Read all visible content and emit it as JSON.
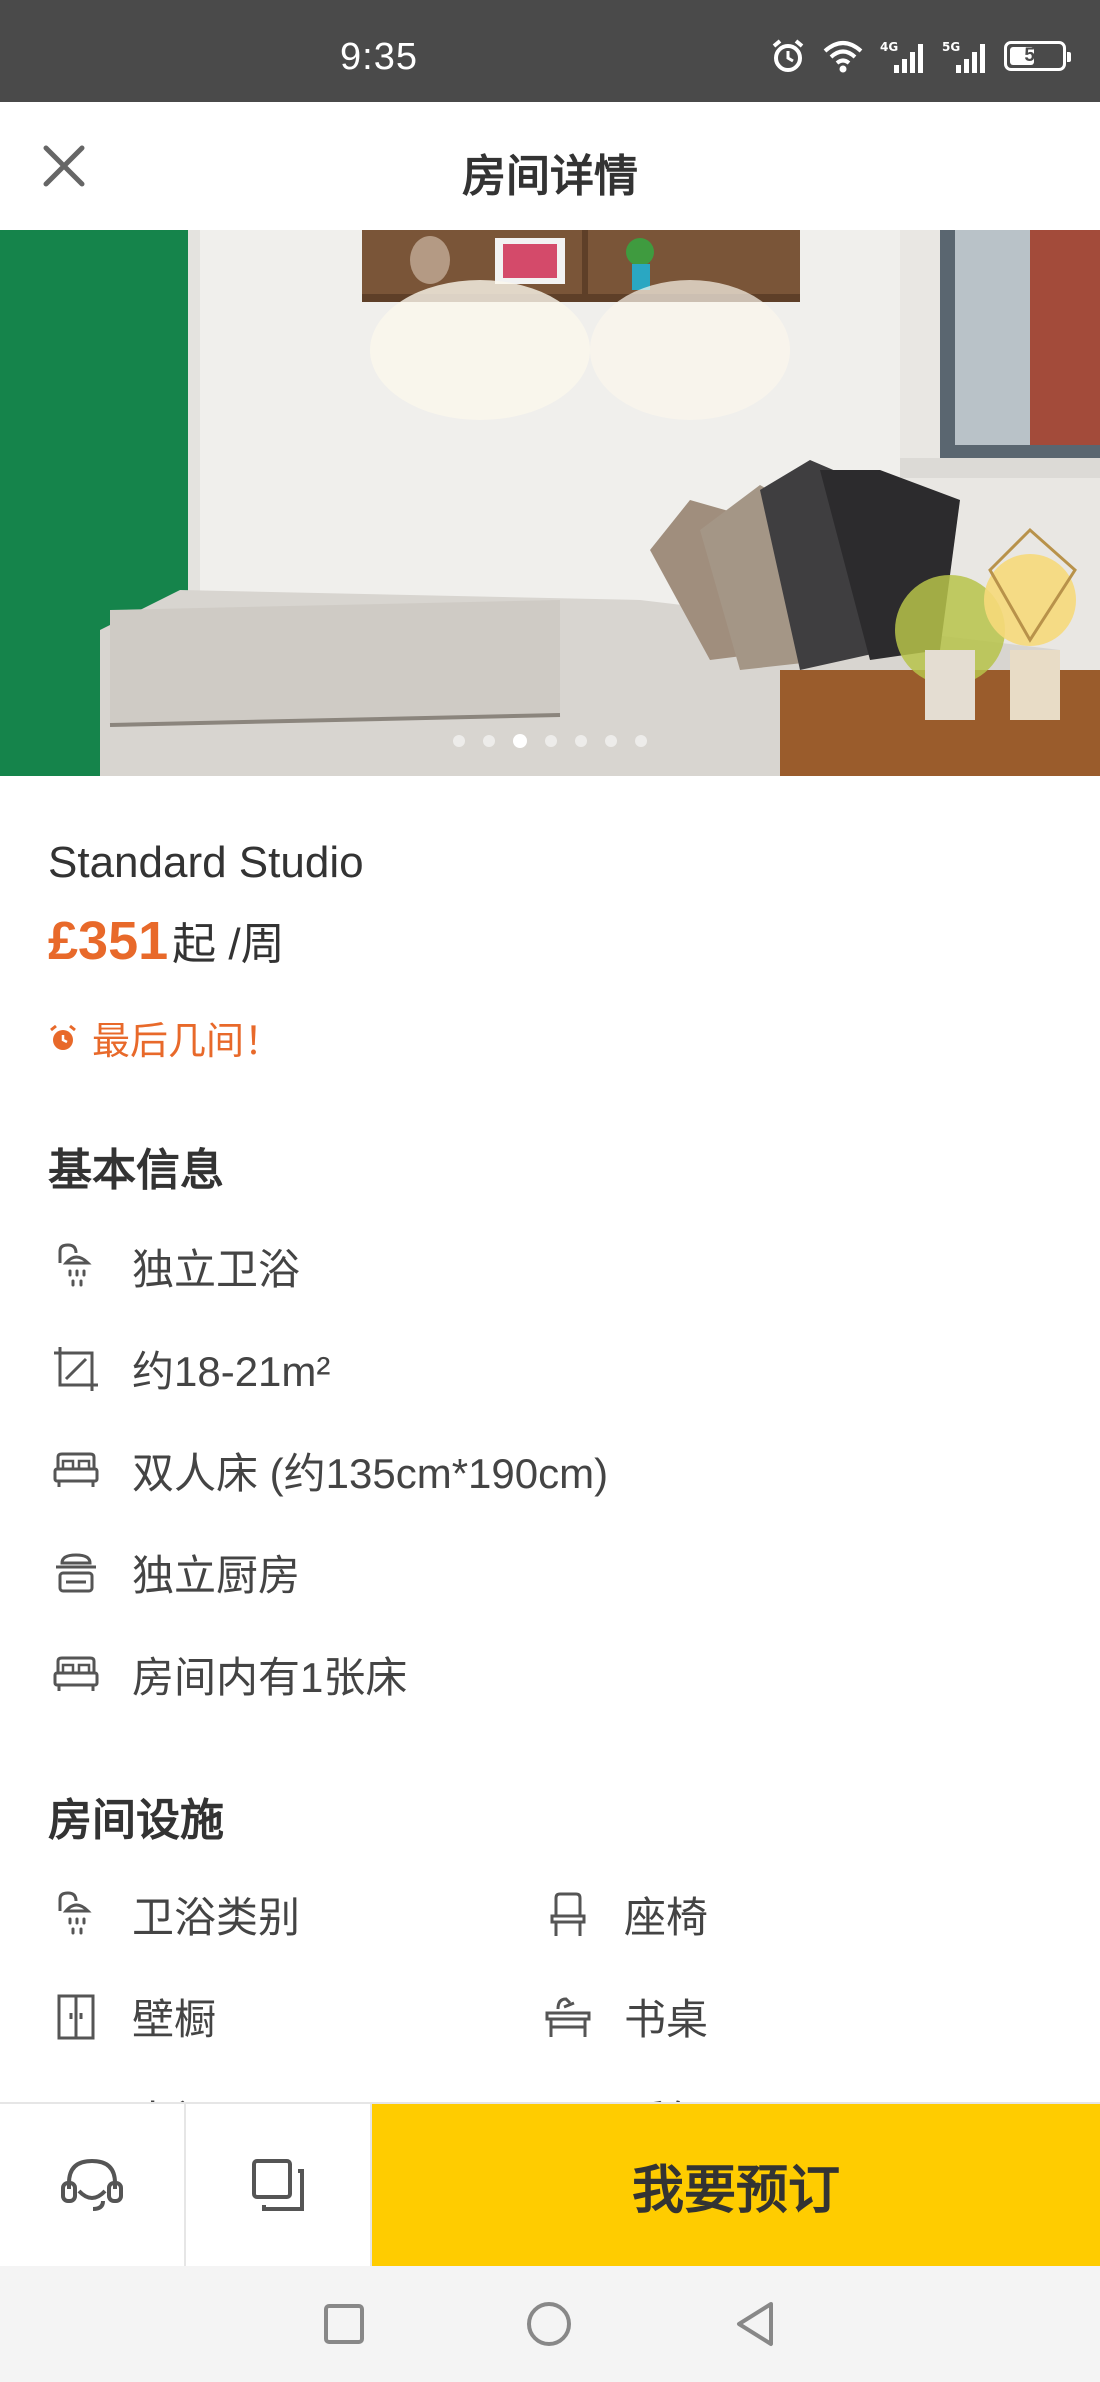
{
  "status_bar": {
    "time": "9:35",
    "battery_level": "51",
    "icons": [
      "alarm-icon",
      "wifi-icon",
      "signal-4g-icon",
      "signal-5g-icon",
      "battery-icon"
    ]
  },
  "header": {
    "title": "房间详情",
    "close_icon": "close-icon"
  },
  "gallery": {
    "image_count": 7,
    "active_index": 2
  },
  "room": {
    "name": "Standard Studio",
    "price": "£351",
    "price_unit": "起 /周",
    "urgency": "最后几间！"
  },
  "basic_info": {
    "title": "基本信息",
    "items": [
      {
        "icon": "shower-icon",
        "label": "独立卫浴"
      },
      {
        "icon": "area-icon",
        "label": "约18-21m²"
      },
      {
        "icon": "bed-icon",
        "label": "双人床 (约135cm*190cm)"
      },
      {
        "icon": "kitchen-icon",
        "label": "独立厨房"
      },
      {
        "icon": "bed-icon",
        "label": "房间内有1张床"
      }
    ]
  },
  "facilities": {
    "title": "房间设施",
    "items": [
      {
        "icon": "shower-icon",
        "label": "卫浴类别"
      },
      {
        "icon": "chair-icon",
        "label": "座椅"
      },
      {
        "icon": "wardrobe-icon",
        "label": "壁橱"
      },
      {
        "icon": "desk-icon",
        "label": "书桌"
      },
      {
        "icon": "tv-icon",
        "label": "电视"
      },
      {
        "icon": "heater-icon",
        "label": "暖气"
      }
    ]
  },
  "action_bar": {
    "support_icon": "headset-icon",
    "compare_icon": "copy-icon",
    "book_label": "我要预订"
  },
  "colors": {
    "accent": "#e8692a",
    "book_button": "#ffcc00",
    "status_bar": "#4a4a4a"
  }
}
